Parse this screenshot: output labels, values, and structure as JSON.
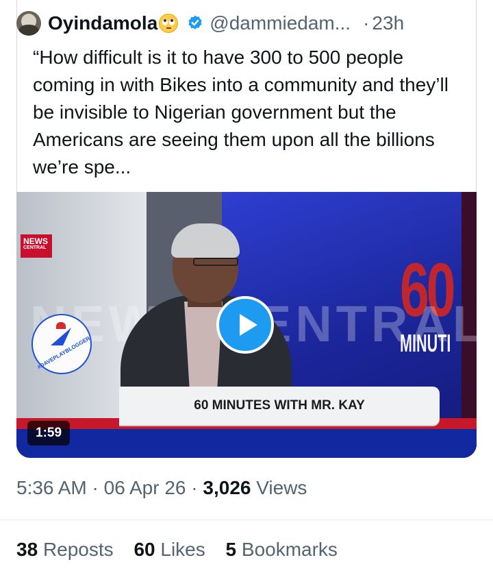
{
  "quoted_tweet": {
    "author_name": "Oyindamola",
    "emoji": "🙄",
    "handle": "@dammiedam...",
    "separator": "·",
    "time": "23h",
    "text": "“How difficult is it to have 300 to 500 people coming in with Bikes into a community and they’ll be invisible to Nigerian government but the Americans are seeing them upon all the billions we’re spe...",
    "media": {
      "channel_logo_line1": "NEWS",
      "channel_logo_line2": "CENTRAL",
      "background_text": "NEWS CENTRAL",
      "side_text_number": "60",
      "side_text_word": "MINUTI",
      "watermark_text": "#DAVEPLAYBLOGGER",
      "lower_third": "60 MINUTES WITH MR. KAY",
      "duration": "1:59"
    }
  },
  "tweet_meta": {
    "time": "5:36 AM",
    "date": "06 Apr 26",
    "separator": "·",
    "views_count": "3,026",
    "views_label": "Views"
  },
  "engagement": {
    "reposts_count": "38",
    "reposts_label": "Reposts",
    "likes_count": "60",
    "likes_label": "Likes",
    "bookmarks_count": "5",
    "bookmarks_label": "Bookmarks"
  },
  "colors": {
    "verified_badge": "#1d9bf0",
    "secondary_text": "#536471",
    "primary_text": "#0f1419",
    "play_button": "#1d9bf0"
  }
}
